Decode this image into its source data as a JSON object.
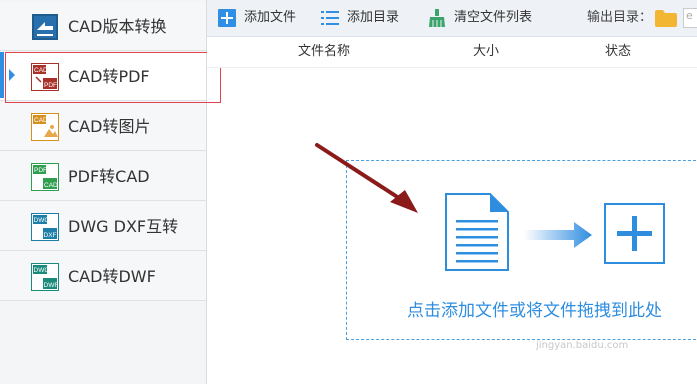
{
  "sidebar": {
    "items": [
      {
        "label": "CAD版本转换",
        "icon": "cad-version-icon"
      },
      {
        "label": "CAD转PDF",
        "icon": "cad-to-pdf-icon"
      },
      {
        "label": "CAD转图片",
        "icon": "cad-to-image-icon"
      },
      {
        "label": "PDF转CAD",
        "icon": "pdf-to-cad-icon"
      },
      {
        "label": "DWG DXF互转",
        "icon": "dwg-dxf-icon"
      },
      {
        "label": "CAD转DWF",
        "icon": "cad-to-dwf-icon"
      }
    ],
    "active_index": 1,
    "icon_texts": {
      "cad": "CAD",
      "pdf": "PDF",
      "dwg": "DWG",
      "dxf": "DXF",
      "dwf": "DWF"
    }
  },
  "toolbar": {
    "add_file": "添加文件",
    "add_folder": "添加目录",
    "clear_list": "清空文件列表",
    "output_dir_label": "输出目录：",
    "output_path_value": "e"
  },
  "table": {
    "columns": [
      "文件名称",
      "大小",
      "状态"
    ]
  },
  "dropzone": {
    "hint": "点击添加文件或将文件拖拽到此处"
  },
  "watermark": "jingyan.baidu.com",
  "colors": {
    "accent": "#2e8fe5",
    "highlight_border": "#e0454f",
    "annotation_arrow": "#8b1a1a"
  }
}
